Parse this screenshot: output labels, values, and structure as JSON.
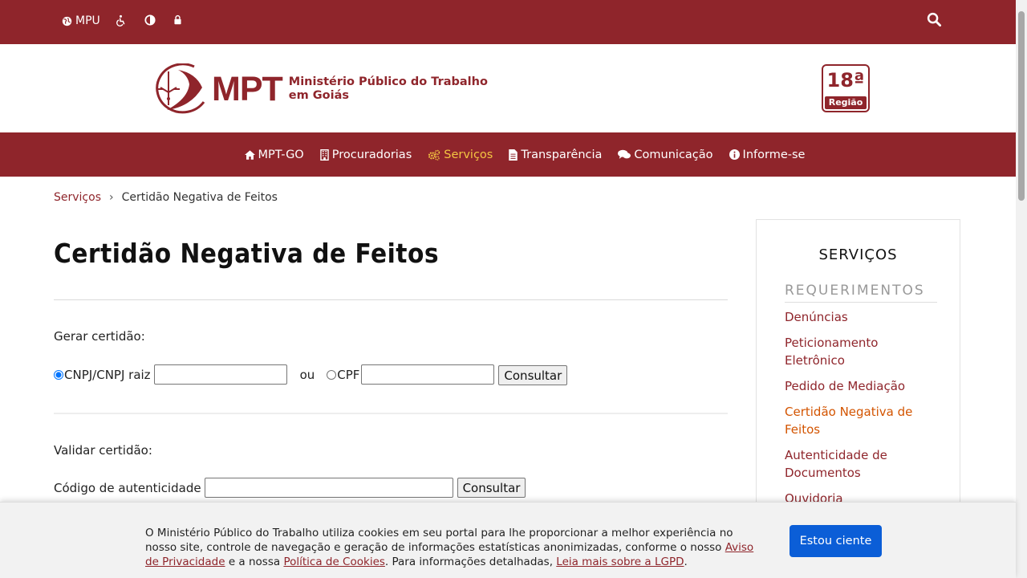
{
  "topbar": {
    "mpu_label": "MPU",
    "icons": [
      "globe-icon",
      "accessibility-icon",
      "contrast-icon",
      "lock-icon",
      "search-icon"
    ]
  },
  "header": {
    "logo_text": "MPT",
    "org_name_line1": "Ministério Público do Trabalho",
    "org_name_line2": "em Goiás",
    "regiao_number": "18ª",
    "regiao_label": "Região"
  },
  "nav": {
    "items": [
      {
        "label": "MPT-GO",
        "icon": "home-icon"
      },
      {
        "label": "Procuradorias",
        "icon": "building-icon"
      },
      {
        "label": "Serviços",
        "icon": "cogs-icon",
        "active": true
      },
      {
        "label": "Transparência",
        "icon": "file-icon"
      },
      {
        "label": "Comunicação",
        "icon": "comments-icon"
      },
      {
        "label": "Informe-se",
        "icon": "info-icon"
      }
    ]
  },
  "breadcrumb": {
    "parent": "Serviços",
    "separator": "›",
    "current": "Certidão Negativa de Feitos"
  },
  "main": {
    "title": "Certidão Negativa de Feitos",
    "gerar": {
      "label": "Gerar certidão:",
      "cnpj_label": "CNPJ/CNPJ raiz",
      "cnpj_value": "",
      "ou_label": "ou",
      "cpf_label": "CPF",
      "cpf_value": "",
      "button": "Consultar"
    },
    "validar": {
      "label": "Validar certidão:",
      "codigo_label": "Código de autenticidade",
      "codigo_value": "",
      "button": "Consultar"
    }
  },
  "sidebar": {
    "title": "SERVIÇOS",
    "group": "REQUERIMENTOS",
    "items": [
      "Denúncias",
      "Peticionamento Eletrônico",
      "Pedido de Mediação",
      "Certidão Negativa de Feitos",
      "Autenticidade de Documentos",
      "Ouvidoria"
    ]
  },
  "cookie": {
    "text_1": "O Ministério Público do Trabalho utiliza cookies em seu portal para lhe proporcionar a melhor experiência no nosso site, controle de navegação e geração de informações estatísticas anonimizadas, conforme o nosso ",
    "link_privacidade": "Aviso de Privacidade",
    "text_2": " e a nossa ",
    "link_cookies": "Política de Cookies",
    "text_3": ". Para informações detalhadas, ",
    "link_lgpd": "Leia mais sobre a LGPD",
    "text_4": ".",
    "accept_button": "Estou ciente"
  },
  "colors": {
    "brand": "#8f252b",
    "active_nav": "#f4c542",
    "active_sidebar": "#d35400",
    "accept_button": "#0b5ed7"
  }
}
